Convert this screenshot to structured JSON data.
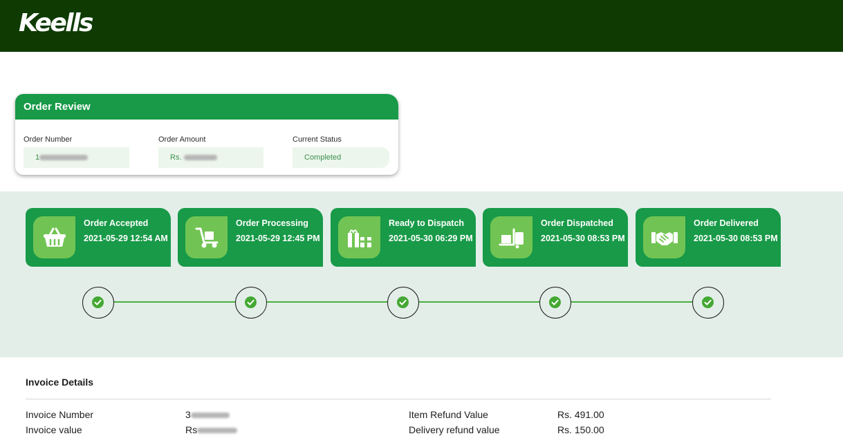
{
  "header": {
    "logo_text": "Keells",
    "bg_color": "#0f3b02"
  },
  "order_review": {
    "title": "Order Review",
    "order_number_label": "Order Number",
    "order_number_value": "1",
    "order_amount_label": "Order Amount",
    "order_amount_value": "Rs.",
    "status_label": "Current Status",
    "status_value": "Completed"
  },
  "stages": [
    {
      "title": "Order Accepted",
      "date": "2021-05-29 12:54 AM",
      "icon": "basket-icon"
    },
    {
      "title": "Order Processing",
      "date": "2021-05-29 12:45 PM",
      "icon": "hand-truck-icon"
    },
    {
      "title": "Ready to Dispatch",
      "date": "2021-05-30 06:29 PM",
      "icon": "gift-boxes-icon"
    },
    {
      "title": "Order Dispatched",
      "date": "2021-05-30 08:53 PM",
      "icon": "forklift-icon"
    },
    {
      "title": "Order Delivered",
      "date": "2021-05-30 08:53 PM",
      "icon": "handshake-icon"
    }
  ],
  "invoice": {
    "title": "Invoice Details",
    "rows": [
      {
        "label": "Invoice Number",
        "value": "3",
        "right_label": "Item Refund Value",
        "right_value": "Rs. 491.00"
      },
      {
        "label": "Invoice value",
        "value": "Rs",
        "right_label": "Delivery refund value",
        "right_value": "Rs. 150.00"
      }
    ]
  },
  "colors": {
    "accent": "#189a48",
    "icon_bg": "#71c453",
    "tracker_bg": "#e3eee9",
    "check": "#44a833"
  }
}
